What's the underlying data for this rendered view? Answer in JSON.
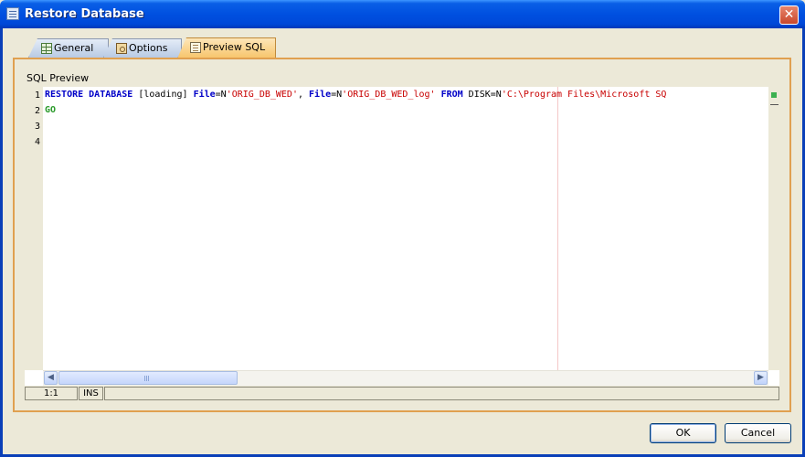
{
  "window": {
    "title": "Restore Database"
  },
  "tabs": [
    {
      "label": "General",
      "icon": "grid-icon",
      "selected": false
    },
    {
      "label": "Options",
      "icon": "options-icon",
      "selected": false
    },
    {
      "label": "Preview SQL",
      "icon": "preview-sql-icon",
      "selected": true
    }
  ],
  "section": {
    "label": "SQL Preview"
  },
  "editor": {
    "line_numbers": [
      "1",
      "2",
      "3",
      "4"
    ],
    "line1": {
      "t1": "RESTORE DATABASE",
      "t2": " [loading] ",
      "t3": "File",
      "t4": "=N",
      "t5": "'ORIG_DB_WED'",
      "t6": ", ",
      "t7": "File",
      "t8": "=N",
      "t9": "'ORIG_DB_WED_log'",
      "t10": " ",
      "t11": "FROM",
      "t12": " DISK=N",
      "t13": "'C:\\Program Files\\Microsoft SQ"
    },
    "line2": "GO"
  },
  "status_bar": {
    "position": "1:1",
    "mode": "INS"
  },
  "buttons": {
    "ok": "OK",
    "cancel": "Cancel"
  },
  "colors": {
    "keyword": "#0000c8",
    "string": "#c80000",
    "go": "#2a9a2a",
    "accent": "#e0a050"
  }
}
